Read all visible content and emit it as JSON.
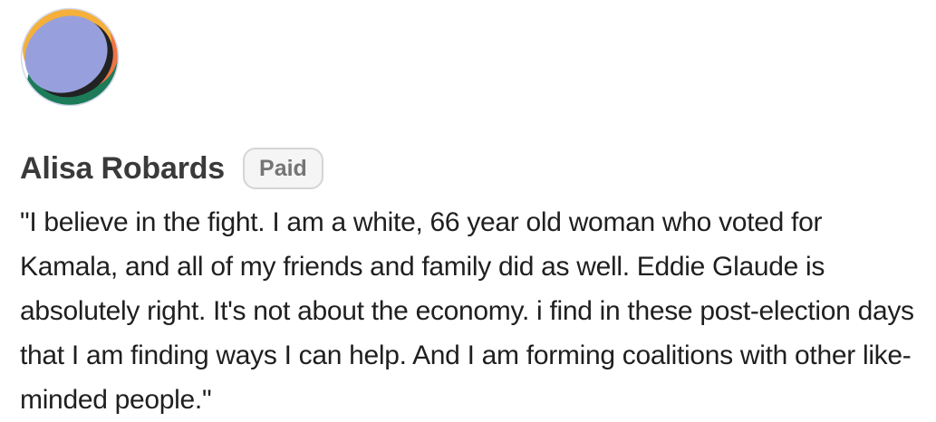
{
  "comment": {
    "author": "Alisa Robards",
    "badge": "Paid",
    "avatar_icon": "abstract-avatar-icon",
    "avatar_colors": {
      "main": "#97A0DC",
      "top": "#F4B03A",
      "right": "#EE7543",
      "bottom": "#1C7B58",
      "shadow": "#222222"
    },
    "body": "\"I believe in the fight. I am a white, 66 year old woman who voted for Kamala, and all of my friends and family did as well. Eddie Glaude is absolutely right. It's not about the economy. i find in these post-election days that I am finding ways I can help. And I am forming coalitions with other like-minded people.\""
  }
}
